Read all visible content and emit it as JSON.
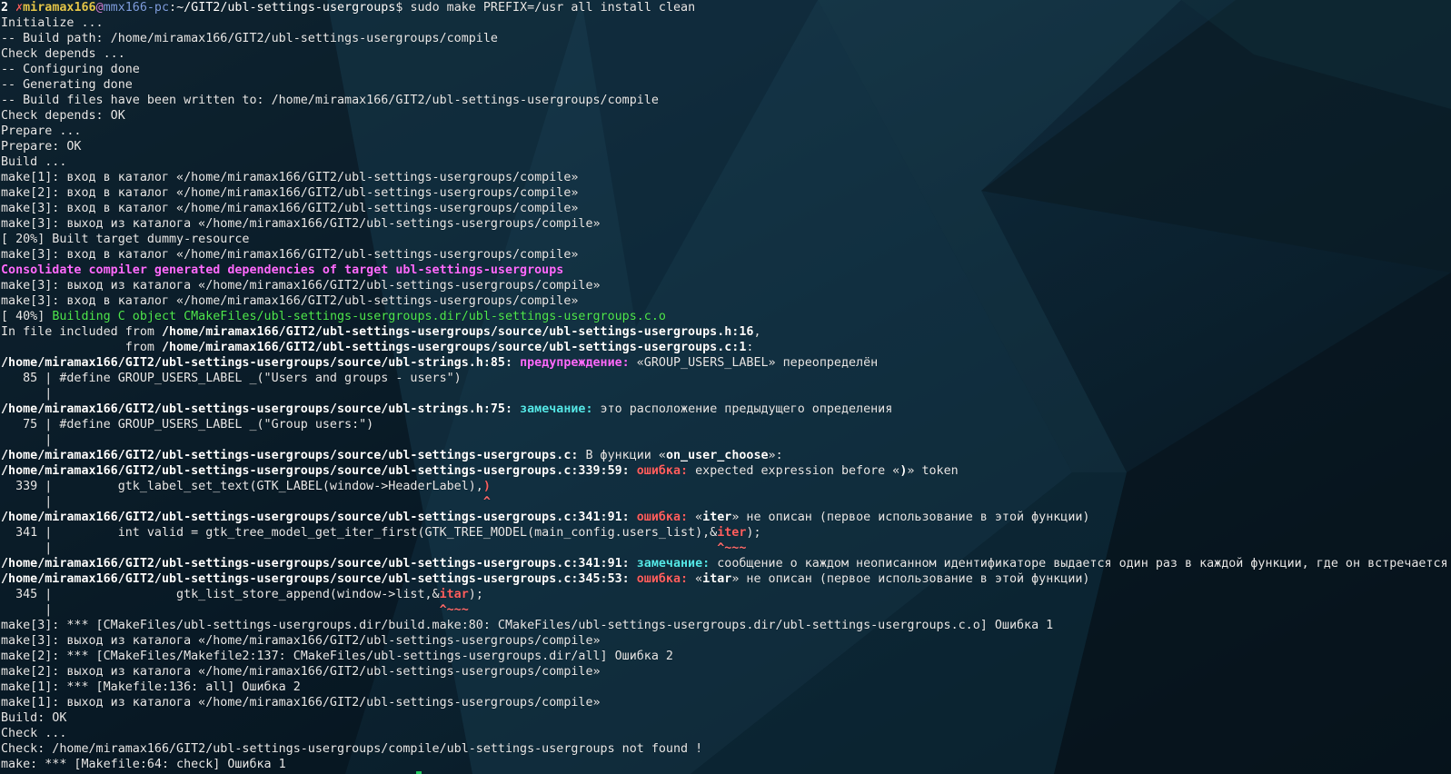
{
  "colors": {
    "default": "#e8e8e8",
    "white_bold": "#ffffff",
    "red": "#ff5f5f",
    "prompt_user": "#e5c74a",
    "prompt_at": "#d47fd4",
    "prompt_host": "#7f9fe0",
    "prompt_path": "#ffffff",
    "magenta": "#ff6bff",
    "green": "#4fe84f",
    "cyan": "#55e8e8",
    "error": "#ff5f5f",
    "caret": "#ff6b6b"
  },
  "terminal": {
    "lines": [
      [
        {
          "t": "2 ",
          "c": "white_bold",
          "b": true
        },
        {
          "t": "✗",
          "c": "red",
          "b": true
        },
        {
          "t": "miramax166",
          "c": "prompt_user",
          "b": true
        },
        {
          "t": "@",
          "c": "prompt_at"
        },
        {
          "t": "mmx166-pc",
          "c": "prompt_host"
        },
        {
          "t": ":",
          "c": "default"
        },
        {
          "t": "~/GIT2/ubl-settings-usergroups",
          "c": "prompt_path"
        },
        {
          "t": "$ sudo make PREFIX=/usr all install clean",
          "c": "default"
        }
      ],
      [
        {
          "t": "Initialize ..."
        }
      ],
      [
        {
          "t": "-- Build path: /home/miramax166/GIT2/ubl-settings-usergroups/compile"
        }
      ],
      [
        {
          "t": "Check depends ..."
        }
      ],
      [
        {
          "t": "-- Configuring done"
        }
      ],
      [
        {
          "t": "-- Generating done"
        }
      ],
      [
        {
          "t": "-- Build files have been written to: /home/miramax166/GIT2/ubl-settings-usergroups/compile"
        }
      ],
      [
        {
          "t": "Check depends: OK"
        }
      ],
      [
        {
          "t": "Prepare ..."
        }
      ],
      [
        {
          "t": "Prepare: OK"
        }
      ],
      [
        {
          "t": "Build ..."
        }
      ],
      [
        {
          "t": "make[1]: вход в каталог «/home/miramax166/GIT2/ubl-settings-usergroups/compile»"
        }
      ],
      [
        {
          "t": "make[2]: вход в каталог «/home/miramax166/GIT2/ubl-settings-usergroups/compile»"
        }
      ],
      [
        {
          "t": "make[3]: вход в каталог «/home/miramax166/GIT2/ubl-settings-usergroups/compile»"
        }
      ],
      [
        {
          "t": "make[3]: выход из каталога «/home/miramax166/GIT2/ubl-settings-usergroups/compile»"
        }
      ],
      [
        {
          "t": "[ 20%] Built target dummy-resource"
        }
      ],
      [
        {
          "t": "make[3]: вход в каталог «/home/miramax166/GIT2/ubl-settings-usergroups/compile»"
        }
      ],
      [
        {
          "t": "Consolidate compiler generated dependencies of target ubl-settings-usergroups",
          "c": "magenta",
          "b": true
        }
      ],
      [
        {
          "t": "make[3]: выход из каталога «/home/miramax166/GIT2/ubl-settings-usergroups/compile»"
        }
      ],
      [
        {
          "t": "make[3]: вход в каталог «/home/miramax166/GIT2/ubl-settings-usergroups/compile»"
        }
      ],
      [
        {
          "t": "[ 40%] "
        },
        {
          "t": "Building C object CMakeFiles/ubl-settings-usergroups.dir/ubl-settings-usergroups.c.o",
          "c": "green"
        }
      ],
      [
        {
          "t": "In file included from "
        },
        {
          "t": "/home/miramax166/GIT2/ubl-settings-usergroups/source/ubl-settings-usergroups.h:16",
          "c": "white_bold",
          "b": true
        },
        {
          "t": ","
        }
      ],
      [
        {
          "t": "                 from "
        },
        {
          "t": "/home/miramax166/GIT2/ubl-settings-usergroups/source/ubl-settings-usergroups.c:1",
          "c": "white_bold",
          "b": true
        },
        {
          "t": ":"
        }
      ],
      [
        {
          "t": "/home/miramax166/GIT2/ubl-settings-usergroups/source/ubl-strings.h:85: ",
          "c": "white_bold",
          "b": true
        },
        {
          "t": "предупреждение: ",
          "c": "magenta",
          "b": true
        },
        {
          "t": "«GROUP_USERS_LABEL» переопределён"
        }
      ],
      [
        {
          "t": "   85 | #define GROUP_USERS_LABEL _(\"Users and groups - users\")"
        }
      ],
      [
        {
          "t": "      |"
        }
      ],
      [
        {
          "t": "/home/miramax166/GIT2/ubl-settings-usergroups/source/ubl-strings.h:75: ",
          "c": "white_bold",
          "b": true
        },
        {
          "t": "замечание: ",
          "c": "cyan",
          "b": true
        },
        {
          "t": "это расположение предыдущего определения"
        }
      ],
      [
        {
          "t": "   75 | #define GROUP_USERS_LABEL _(\"Group users:\")"
        }
      ],
      [
        {
          "t": "      |"
        }
      ],
      [
        {
          "t": "/home/miramax166/GIT2/ubl-settings-usergroups/source/ubl-settings-usergroups.c:",
          "c": "white_bold",
          "b": true
        },
        {
          "t": " В функции «"
        },
        {
          "t": "on_user_choose",
          "c": "white_bold",
          "b": true
        },
        {
          "t": "»:"
        }
      ],
      [
        {
          "t": "/home/miramax166/GIT2/ubl-settings-usergroups/source/ubl-settings-usergroups.c:339:59: ",
          "c": "white_bold",
          "b": true
        },
        {
          "t": "ошибка: ",
          "c": "error",
          "b": true
        },
        {
          "t": "expected expression before «"
        },
        {
          "t": ")",
          "c": "white_bold",
          "b": true
        },
        {
          "t": "» token"
        }
      ],
      [
        {
          "t": "  339 |         gtk_label_set_text(GTK_LABEL(window->HeaderLabel),"
        },
        {
          "t": ")",
          "c": "error",
          "b": true
        }
      ],
      [
        {
          "t": "      |                                                           "
        },
        {
          "t": "^",
          "c": "caret",
          "b": true
        }
      ],
      [
        {
          "t": "/home/miramax166/GIT2/ubl-settings-usergroups/source/ubl-settings-usergroups.c:341:91: ",
          "c": "white_bold",
          "b": true
        },
        {
          "t": "ошибка: ",
          "c": "error",
          "b": true
        },
        {
          "t": "«"
        },
        {
          "t": "iter",
          "c": "white_bold",
          "b": true
        },
        {
          "t": "» не описан (первое использование в этой функции)"
        }
      ],
      [
        {
          "t": "  341 |         int valid = gtk_tree_model_get_iter_first(GTK_TREE_MODEL(main_config.users_list),&"
        },
        {
          "t": "iter",
          "c": "error",
          "b": true
        },
        {
          "t": ");"
        }
      ],
      [
        {
          "t": "      |                                                                                           "
        },
        {
          "t": "^~~~",
          "c": "caret",
          "b": true
        }
      ],
      [
        {
          "t": "/home/miramax166/GIT2/ubl-settings-usergroups/source/ubl-settings-usergroups.c:341:91: ",
          "c": "white_bold",
          "b": true
        },
        {
          "t": "замечание: ",
          "c": "cyan",
          "b": true
        },
        {
          "t": "сообщение о каждом неописанном идентификаторе выдается один раз в каждой функции, где он встречается"
        }
      ],
      [
        {
          "t": "/home/miramax166/GIT2/ubl-settings-usergroups/source/ubl-settings-usergroups.c:345:53: ",
          "c": "white_bold",
          "b": true
        },
        {
          "t": "ошибка: ",
          "c": "error",
          "b": true
        },
        {
          "t": "«"
        },
        {
          "t": "itar",
          "c": "white_bold",
          "b": true
        },
        {
          "t": "» не описан (первое использование в этой функции)"
        }
      ],
      [
        {
          "t": "  345 |                 gtk_list_store_append(window->list,&"
        },
        {
          "t": "itar",
          "c": "error",
          "b": true
        },
        {
          "t": ");"
        }
      ],
      [
        {
          "t": "      |                                                     "
        },
        {
          "t": "^~~~",
          "c": "caret",
          "b": true
        }
      ],
      [
        {
          "t": "make[3]: *** [CMakeFiles/ubl-settings-usergroups.dir/build.make:80: CMakeFiles/ubl-settings-usergroups.dir/ubl-settings-usergroups.c.o] Ошибка 1"
        }
      ],
      [
        {
          "t": "make[3]: выход из каталога «/home/miramax166/GIT2/ubl-settings-usergroups/compile»"
        }
      ],
      [
        {
          "t": "make[2]: *** [CMakeFiles/Makefile2:137: CMakeFiles/ubl-settings-usergroups.dir/all] Ошибка 2"
        }
      ],
      [
        {
          "t": "make[2]: выход из каталога «/home/miramax166/GIT2/ubl-settings-usergroups/compile»"
        }
      ],
      [
        {
          "t": "make[1]: *** [Makefile:136: all] Ошибка 2"
        }
      ],
      [
        {
          "t": "make[1]: выход из каталога «/home/miramax166/GIT2/ubl-settings-usergroups/compile»"
        }
      ],
      [
        {
          "t": "Build: OK"
        }
      ],
      [
        {
          "t": "Check ..."
        }
      ],
      [
        {
          "t": "Check: /home/miramax166/GIT2/ubl-settings-usergroups/compile/ubl-settings-usergroups not found !"
        }
      ],
      [
        {
          "t": "make: *** [Makefile:64: check] Ошибка 1"
        }
      ]
    ]
  }
}
